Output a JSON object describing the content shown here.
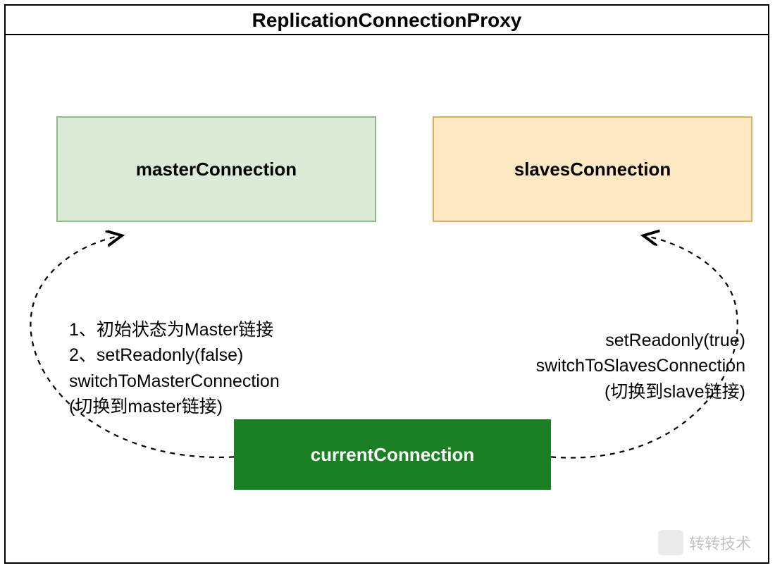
{
  "proxy": {
    "title": "ReplicationConnectionProxy",
    "boxes": {
      "master": "masterConnection",
      "slaves": "slavesConnection",
      "current": "currentConnection"
    },
    "labels": {
      "left_line1": "1、初始状态为Master链接",
      "left_line2": "2、setReadonly(false)",
      "left_line3": "switchToMasterConnection",
      "left_line4": "(切换到master链接)",
      "right_line1": "setReadonly(true)",
      "right_line2": "switchToSlavesConnection",
      "right_line3": "(切换到slave链接)"
    }
  },
  "watermark": {
    "text": "转转技术"
  }
}
